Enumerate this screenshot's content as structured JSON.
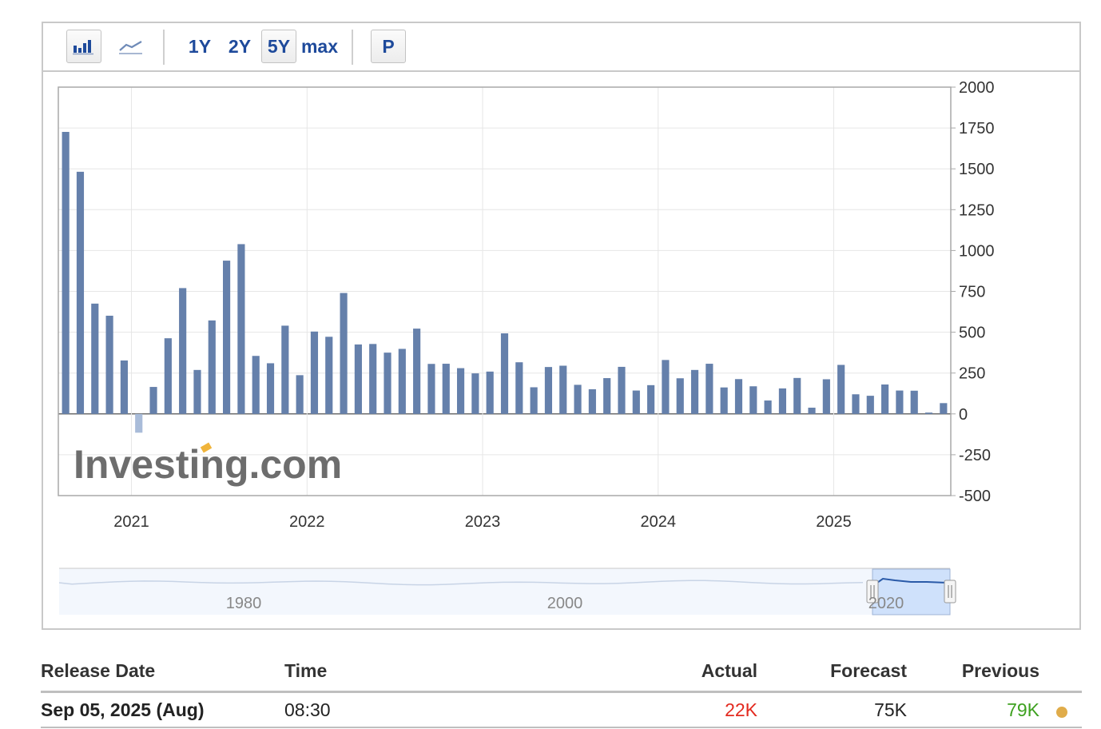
{
  "toolbar": {
    "bar_icon": "bar-chart-icon",
    "line_icon": "line-chart-icon",
    "range_1y": "1Y",
    "range_2y": "2Y",
    "range_5y": "5Y",
    "range_max": "max",
    "p_button": "P",
    "selected_range": "5Y"
  },
  "watermark": "Investing.com",
  "colors": {
    "bar": "#6580ab",
    "negative_bar": "#a9bcd9",
    "actual": "#e32a1f",
    "previous": "#3ea120",
    "dot": "#e0ac4a",
    "navigator_fill": "#cfe1fb"
  },
  "chart_data": {
    "type": "bar",
    "x_unit": "month",
    "x_start": "2020-08",
    "x_end": "2025-08",
    "values": [
      1726,
      1482,
      675,
      601,
      327,
      -115,
      165,
      463,
      770,
      269,
      572,
      938,
      1039,
      355,
      310,
      540,
      237,
      504,
      472,
      740,
      425,
      428,
      375,
      398,
      522,
      306,
      307,
      280,
      248,
      259,
      493,
      316,
      163,
      287,
      295,
      178,
      151,
      219,
      288,
      143,
      176,
      330,
      218,
      269,
      307,
      162,
      213,
      169,
      82,
      156,
      220,
      38,
      212,
      300,
      120,
      111,
      180,
      143,
      142,
      8,
      66
    ],
    "ylim": [
      -500,
      2000
    ],
    "y_ticks": [
      -500,
      -250,
      0,
      250,
      500,
      750,
      1000,
      1250,
      1500,
      1750,
      2000
    ],
    "x_ticks": [
      "2021",
      "2022",
      "2023",
      "2024",
      "2025"
    ],
    "grid": true,
    "navigator": {
      "labels": [
        "1980",
        "2000",
        "2020"
      ],
      "selected_range": "2020-2025"
    }
  },
  "table": {
    "headers": {
      "release_date": "Release Date",
      "time": "Time",
      "actual": "Actual",
      "forecast": "Forecast",
      "previous": "Previous"
    },
    "rows": [
      {
        "release_date": "Sep 05, 2025 (Aug)",
        "time": "08:30",
        "actual": "22K",
        "forecast": "75K",
        "previous": "79K"
      }
    ]
  }
}
